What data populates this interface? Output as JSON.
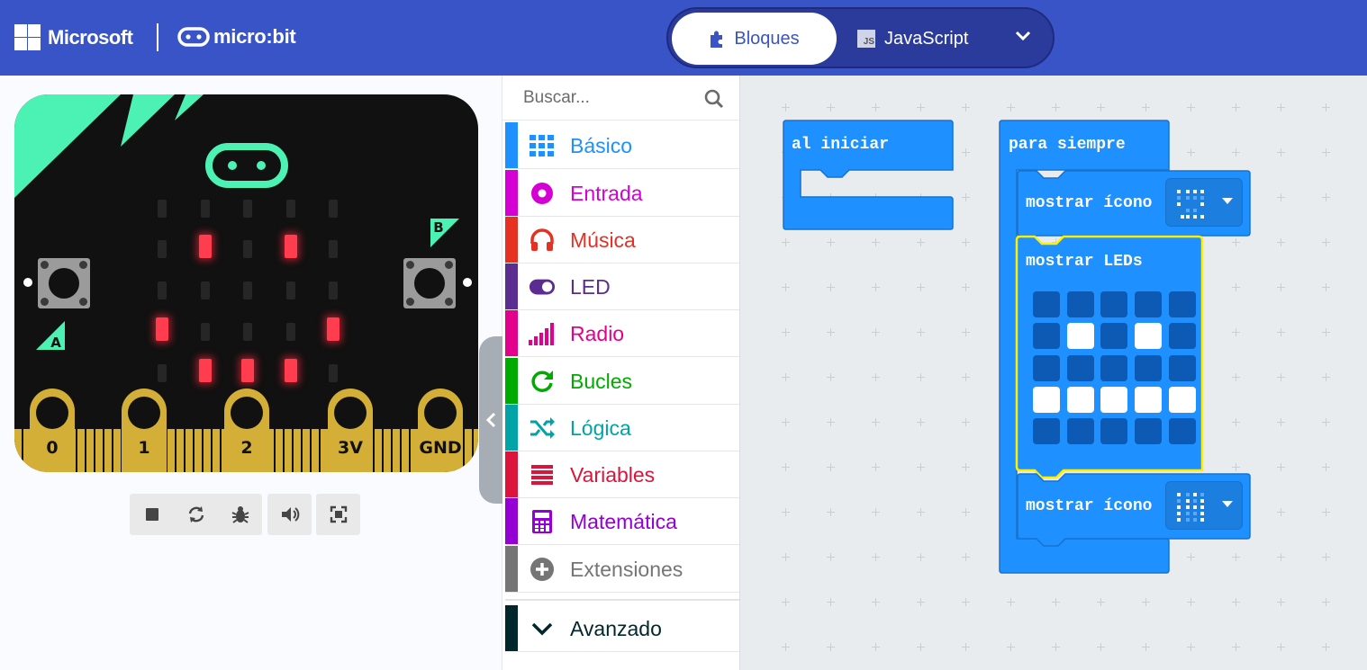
{
  "header": {
    "brand": "Microsoft",
    "product": "micro:bit",
    "tabs": [
      {
        "label": "Bloques",
        "active": true
      },
      {
        "label": "JavaScript",
        "active": false
      }
    ]
  },
  "simulator": {
    "pins": [
      "0",
      "1",
      "2",
      "3V",
      "GND"
    ],
    "button_a": "A",
    "button_b": "B",
    "leds": [
      [
        0,
        0,
        0,
        0,
        0
      ],
      [
        0,
        1,
        0,
        1,
        0
      ],
      [
        0,
        0,
        0,
        0,
        0
      ],
      [
        1,
        0,
        0,
        0,
        1
      ],
      [
        0,
        1,
        1,
        1,
        0
      ]
    ],
    "tools": [
      "stop-icon",
      "restart-icon",
      "debug-icon",
      "sound-icon",
      "fullscreen-icon"
    ]
  },
  "toolbox": {
    "search_placeholder": "Buscar...",
    "categories": [
      {
        "label": "Básico",
        "color": "#1e90ff",
        "icon": "grid-icon"
      },
      {
        "label": "Entrada",
        "color": "#d400d4",
        "icon": "input-icon"
      },
      {
        "label": "Música",
        "color": "#e63022",
        "icon": "headphones-icon"
      },
      {
        "label": "LED",
        "color": "#5c2d91",
        "icon": "toggle-icon"
      },
      {
        "label": "Radio",
        "color": "#e3008c",
        "icon": "signal-icon"
      },
      {
        "label": "Bucles",
        "color": "#00aa00",
        "icon": "loop-icon"
      },
      {
        "label": "Lógica",
        "color": "#00a4a6",
        "icon": "shuffle-icon"
      },
      {
        "label": "Variables",
        "color": "#dc143c",
        "icon": "list-icon"
      },
      {
        "label": "Matemática",
        "color": "#9400d3",
        "icon": "calculator-icon"
      },
      {
        "label": "Extensiones",
        "color": "#757575",
        "icon": "plus-circle-icon"
      }
    ],
    "advanced": {
      "label": "Avanzado",
      "color": "#00272b",
      "icon": "chevron-down-icon"
    }
  },
  "workspace": {
    "on_start": {
      "label": "al iniciar"
    },
    "forever": {
      "label": "para siempre",
      "show_icon_1": {
        "label": "mostrar ícono"
      },
      "show_leds": {
        "label": "mostrar LEDs",
        "grid": [
          [
            0,
            0,
            0,
            0,
            0
          ],
          [
            0,
            1,
            0,
            1,
            0
          ],
          [
            0,
            0,
            0,
            0,
            0
          ],
          [
            1,
            1,
            1,
            1,
            1
          ],
          [
            0,
            0,
            0,
            0,
            0
          ]
        ]
      },
      "show_icon_2": {
        "label": "mostrar ícono"
      }
    }
  },
  "colors": {
    "header": "#3954c7",
    "block": "#1e90ff",
    "workspace": "#e9ecef"
  }
}
